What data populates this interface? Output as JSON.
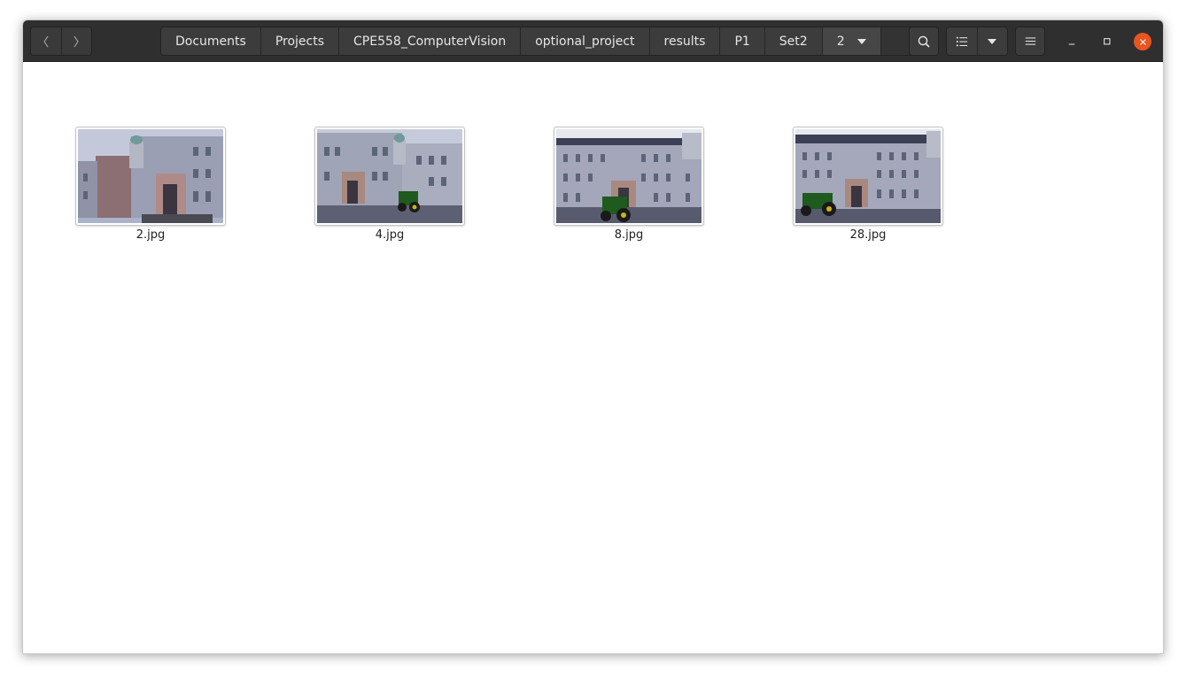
{
  "nav": {
    "back_icon": "chevron-left-icon",
    "forward_icon": "chevron-right-icon"
  },
  "breadcrumb": {
    "items": [
      "Documents",
      "Projects",
      "CPE558_ComputerVision",
      "optional_project",
      "results",
      "P1",
      "Set2",
      "2"
    ]
  },
  "toolbar": {
    "search_icon": "search-icon",
    "view_icon": "list-view-icon",
    "view_dropdown_icon": "caret-down-icon",
    "menu_icon": "hamburger-menu-icon"
  },
  "window_controls": {
    "minimize_icon": "minimize-icon",
    "maximize_icon": "maximize-icon",
    "close_icon": "close-icon"
  },
  "colors": {
    "headerbar": "#2f2f2f",
    "accent_close": "#e95420",
    "content_bg": "#ffffff"
  },
  "files": [
    {
      "name": "2.jpg"
    },
    {
      "name": "4.jpg"
    },
    {
      "name": "8.jpg"
    },
    {
      "name": "28.jpg"
    }
  ]
}
